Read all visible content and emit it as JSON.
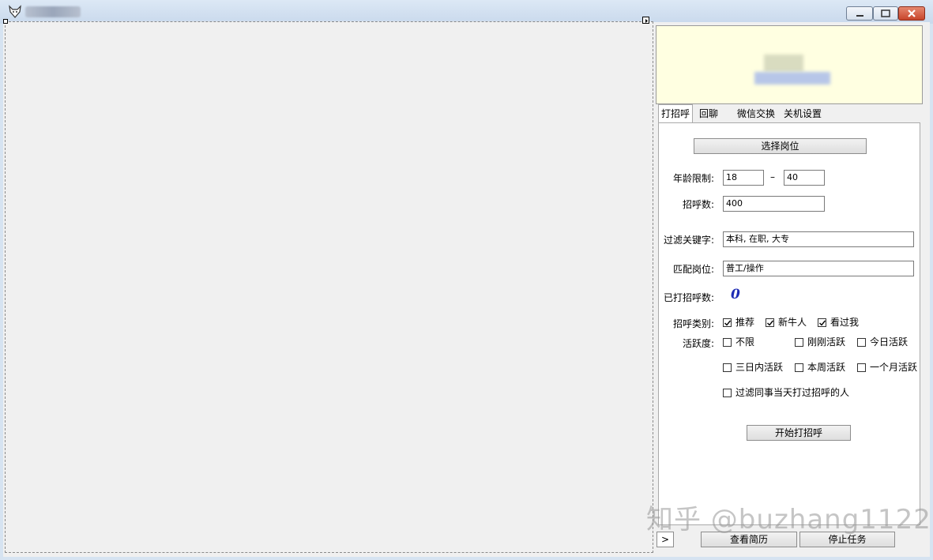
{
  "tabs": [
    "打招呼",
    "回聊",
    "微信交换",
    "关机设置"
  ],
  "greet": {
    "select_position_label": "选择岗位",
    "age_label": "年龄限制:",
    "age_min": "18",
    "age_sep": "–",
    "age_max": "40",
    "greet_count_label": "招呼数:",
    "greet_count": "400",
    "filter_keywords_label": "过滤关键字:",
    "filter_keywords": "本科, 在职, 大专",
    "match_position_label": "匹配岗位:",
    "match_position": "普工/操作",
    "greeted_label": "已打招呼数:",
    "greeted_value": "0",
    "category_label": "招呼类别:",
    "categories": [
      {
        "label": "推荐",
        "checked": true
      },
      {
        "label": "新牛人",
        "checked": true
      },
      {
        "label": "看过我",
        "checked": true
      }
    ],
    "activity_label": "活跃度:",
    "activity": [
      {
        "label": "不限",
        "checked": false
      },
      {
        "label": "刚刚活跃",
        "checked": false
      },
      {
        "label": "今日活跃",
        "checked": false
      },
      {
        "label": "三日内活跃",
        "checked": false
      },
      {
        "label": "本周活跃",
        "checked": false
      },
      {
        "label": "一个月活跃",
        "checked": false
      }
    ],
    "filter_colleague_label": "过滤同事当天打过招呼的人",
    "filter_colleague_checked": false,
    "start_label": "开始打招呼"
  },
  "footer": {
    "arrow_label": ">",
    "view_resume_label": "查看简历",
    "stop_task_label": "停止任务"
  },
  "watermark": "知乎 @buzhang1122"
}
